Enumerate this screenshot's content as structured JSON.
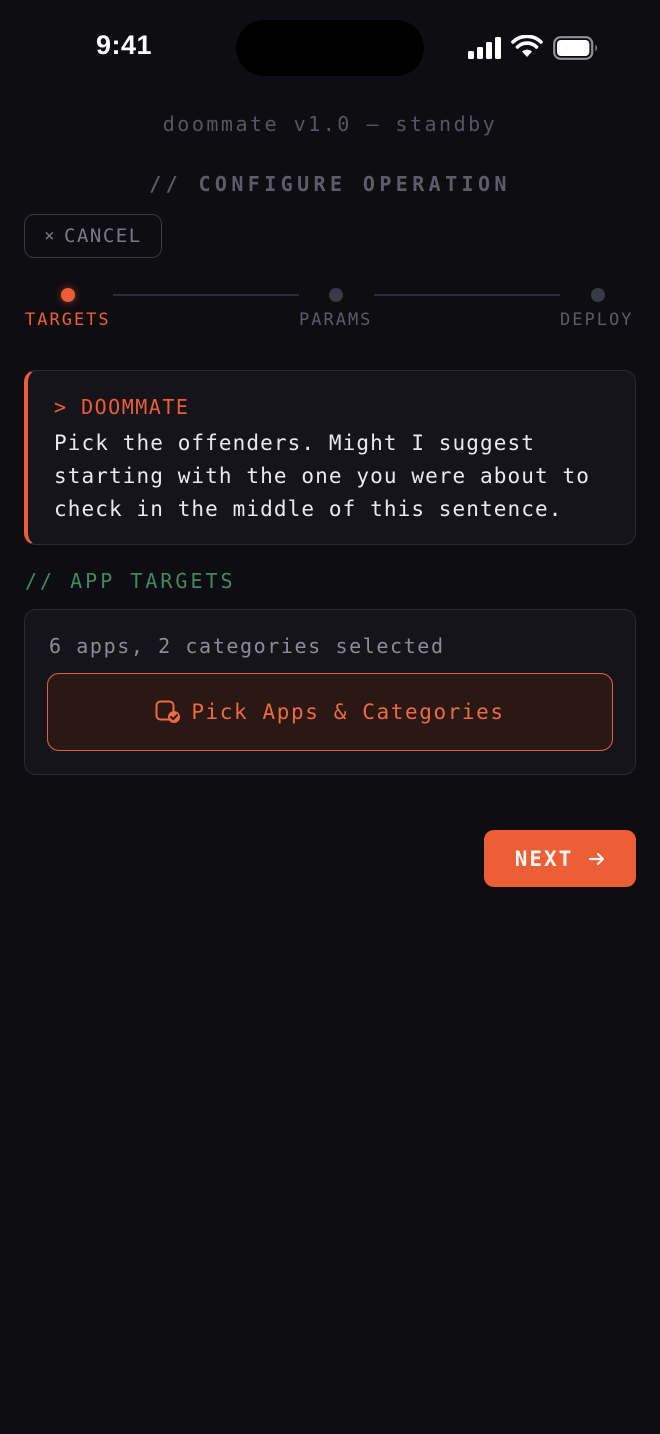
{
  "status_bar": {
    "time": "9:41"
  },
  "header": {
    "app_version": "doommate v1.0 — standby",
    "section_title": "// CONFIGURE OPERATION",
    "cancel_icon": "×",
    "cancel_label": "CANCEL"
  },
  "stepper": {
    "active_step": 0,
    "steps": [
      {
        "label": "TARGETS"
      },
      {
        "label": "PARAMS"
      },
      {
        "label": "DEPLOY"
      }
    ]
  },
  "message": {
    "sender": "> DOOMMATE",
    "body": "Pick the offenders. Might I suggest starting with the one you were about to check in the middle of this sentence."
  },
  "app_targets": {
    "section_label": "// APP TARGETS",
    "summary": "6 apps, 2 categories selected",
    "pick_button_label": "Pick Apps & Categories",
    "pick_button_icon": "app-select-check-icon"
  },
  "next_button": {
    "label": "NEXT",
    "icon": "arrow-right-icon"
  },
  "colors": {
    "background": "#0e0d12",
    "accent": "#ec5e36",
    "section_green": "#3f8a63",
    "card": "#15141b"
  }
}
